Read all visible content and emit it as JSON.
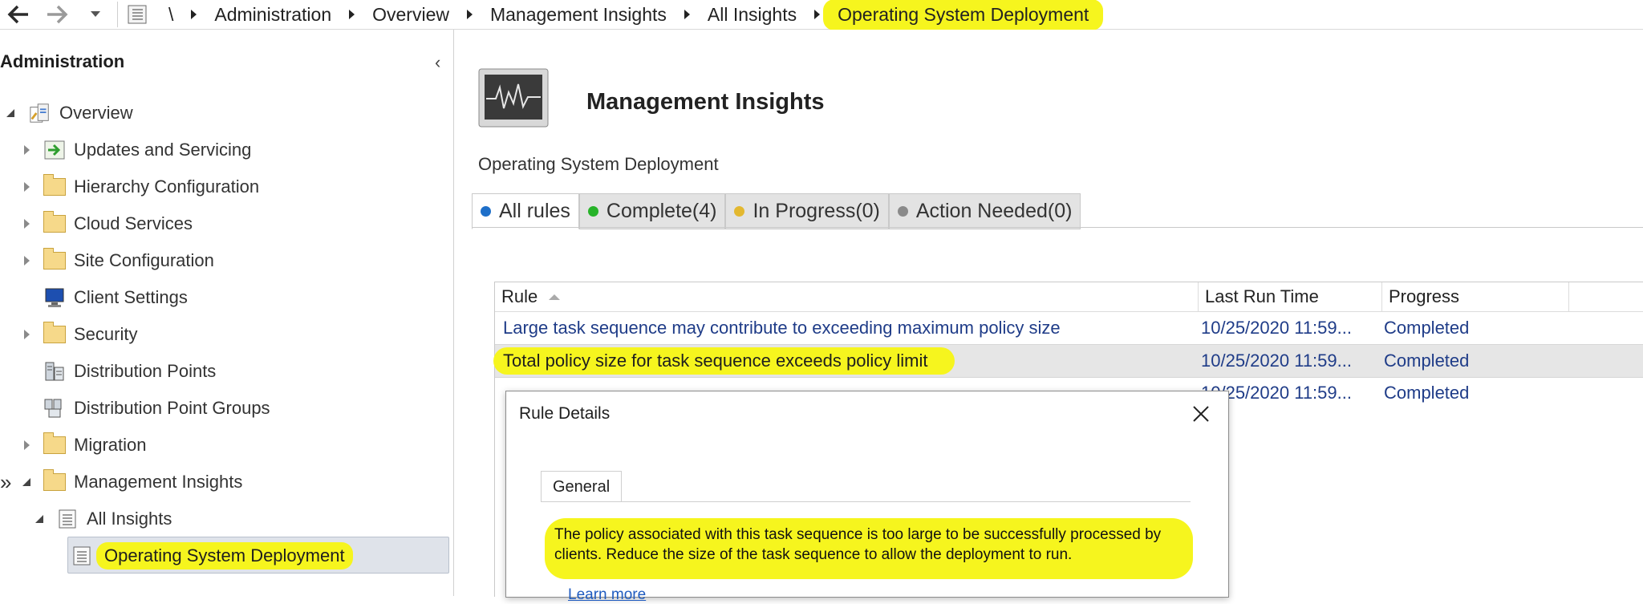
{
  "breadcrumb": {
    "root": "\\",
    "items": [
      "Administration",
      "Overview",
      "Management Insights",
      "All Insights"
    ],
    "current": "Operating System Deployment"
  },
  "left_panel": {
    "title": "Administration",
    "tree": [
      {
        "label": "Overview",
        "icon": "overview-icon",
        "expanded": true
      },
      {
        "label": "Updates and Servicing",
        "icon": "updates-icon"
      },
      {
        "label": "Hierarchy Configuration",
        "icon": "folder-icon"
      },
      {
        "label": "Cloud Services",
        "icon": "folder-icon"
      },
      {
        "label": "Site Configuration",
        "icon": "folder-icon"
      },
      {
        "label": "Client Settings",
        "icon": "monitor-icon"
      },
      {
        "label": "Security",
        "icon": "folder-icon"
      },
      {
        "label": "Distribution Points",
        "icon": "server-icon"
      },
      {
        "label": "Distribution Point Groups",
        "icon": "server-group-icon"
      },
      {
        "label": "Migration",
        "icon": "folder-icon"
      },
      {
        "label": "Management Insights",
        "icon": "folder-icon"
      },
      {
        "label": "All Insights",
        "icon": "list-icon",
        "expanded": true
      },
      {
        "label": "Operating System Deployment",
        "icon": "list-icon",
        "selected": true
      }
    ]
  },
  "main": {
    "title": "Management Insights",
    "subtitle": "Operating System Deployment",
    "tabs": [
      {
        "label": "All rules",
        "dot": "#1e6fc9",
        "active": true
      },
      {
        "label": "Complete(4)",
        "dot": "#27b329"
      },
      {
        "label": "In Progress(0)",
        "dot": "#e3b830"
      },
      {
        "label": "Action Needed(0)",
        "dot": "#8a8a8a"
      }
    ],
    "columns": {
      "rule": "Rule",
      "time": "Last Run Time",
      "progress": "Progress"
    },
    "rows": [
      {
        "rule": "Large task sequence may contribute to exceeding maximum policy size",
        "time": "10/25/2020 11:59...",
        "progress": "Completed"
      },
      {
        "rule": "Total policy size for task sequence exceeds policy limit",
        "time": "10/25/2020 11:59...",
        "progress": "Completed"
      },
      {
        "rule": "",
        "time": "10/25/2020 11:59...",
        "progress": "Completed"
      }
    ]
  },
  "dialog": {
    "title": "Rule Details",
    "tab": "General",
    "text": "The policy associated with this task sequence is too large to be successfully processed by clients. Reduce the size of the task sequence to allow the deployment to run.",
    "link": "Learn more"
  },
  "colors": {
    "highlight": "#f6f51e",
    "link": "#1f3c88"
  }
}
